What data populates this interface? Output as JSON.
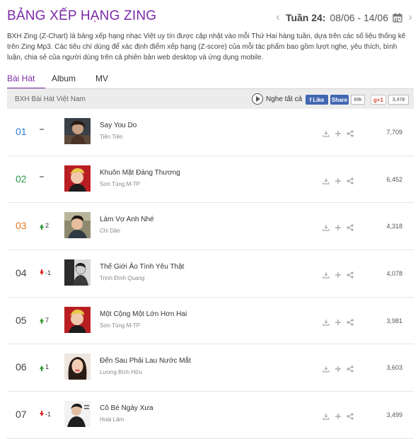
{
  "header": {
    "title": "BẢNG XẾP HẠNG ZING",
    "week_label": "Tuần 24:",
    "week_range": "08/06 - 14/06",
    "prev_icon": "chevron-left-icon",
    "next_icon": "chevron-right-icon",
    "calendar_icon": "calendar-icon"
  },
  "description": "BXH Zing (Z-Chart) là bảng xếp hạng nhạc Việt uy tín được cập nhật vào mỗi Thứ Hai hàng tuần, dựa trên các số liệu thống kê trên Zing Mp3. Các tiêu chí dùng để xác định điểm xếp hạng (Z-score) của mỗi tác phẩm bao gồm lượt nghe, yêu thích, bình luận, chia sẻ của người dùng trên cả phiên bản web desktop và ứng dụng mobile.",
  "tabs": [
    {
      "label": "Bài Hát",
      "active": true
    },
    {
      "label": "Album",
      "active": false
    },
    {
      "label": "MV",
      "active": false
    }
  ],
  "toolbar": {
    "title": "BXH Bài Hát Việt Nam",
    "play_all": "Nghe tất cả",
    "fb_like": "Like",
    "fb_share": "Share",
    "fb_count": "89k",
    "gplus": "g+1",
    "gplus_count": "3,478"
  },
  "colors": {
    "accent": "#7b2aa8",
    "rank_1": "#2a7bd8",
    "rank_2": "#2e9b4e",
    "rank_3": "#e0791b",
    "rank_other": "#444444",
    "up": "#2e9b2e",
    "down": "#dd2222"
  },
  "songs": [
    {
      "rank": "01",
      "change": "-",
      "direction": "none",
      "title": "Say You Do",
      "artist": "Tiên Tiên",
      "listens": "7,709"
    },
    {
      "rank": "02",
      "change": "-",
      "direction": "none",
      "title": "Khuôn Mặt Đáng Thương",
      "artist": "Sơn Tùng M-TP",
      "listens": "6,452"
    },
    {
      "rank": "03",
      "change": "2",
      "direction": "up",
      "title": "Làm Vợ Anh Nhé",
      "artist": "Chi Dân",
      "listens": "4,318"
    },
    {
      "rank": "04",
      "change": "-1",
      "direction": "down",
      "title": "Thế Giới Ảo Tình Yêu Thật",
      "artist": "Trịnh Đình Quang",
      "listens": "4,078"
    },
    {
      "rank": "05",
      "change": "7",
      "direction": "up",
      "title": "Một Cộng Một Lớn Hơn Hai",
      "artist": "Sơn Tùng M-TP",
      "listens": "3,981"
    },
    {
      "rank": "06",
      "change": "1",
      "direction": "up",
      "title": "Đến Sau Phải Lau Nước Mắt",
      "artist": "Lương Bích Hữu",
      "listens": "3,603"
    },
    {
      "rank": "07",
      "change": "-1",
      "direction": "down",
      "title": "Cô Bé Ngày Xưa",
      "artist": "Hoài Lâm",
      "listens": "3,499"
    }
  ]
}
